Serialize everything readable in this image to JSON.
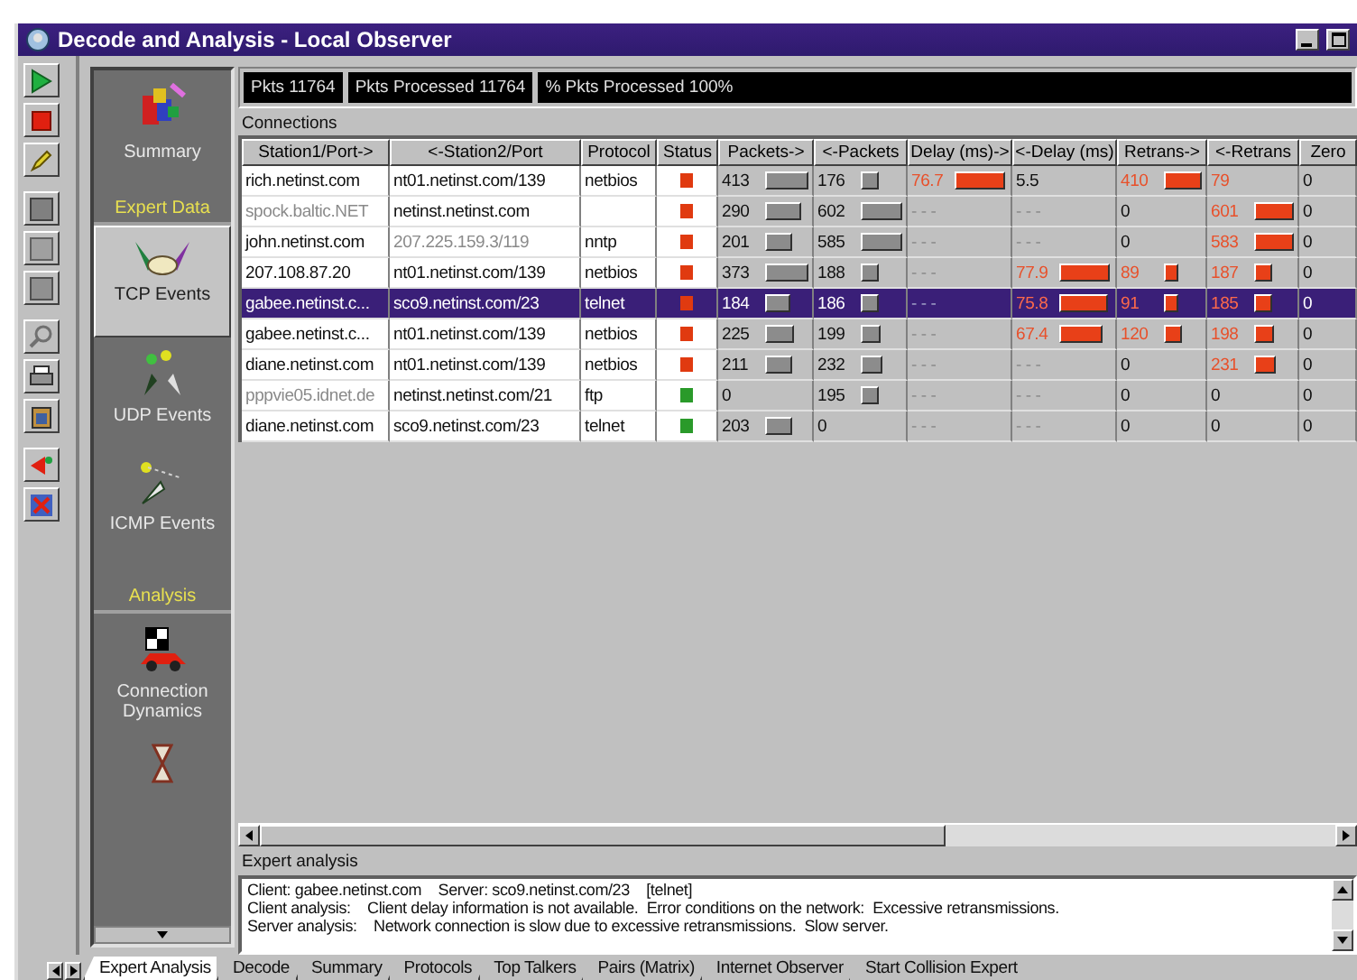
{
  "window": {
    "title": "Decode and Analysis - Local Observer"
  },
  "stats": [
    "Pkts 11764",
    "Pkts Processed 11764",
    "% Pkts Processed 100%"
  ],
  "sidebar": {
    "items": [
      {
        "kind": "item",
        "label": "Summary",
        "selected": false
      },
      {
        "kind": "heading",
        "label": "Expert Data"
      },
      {
        "kind": "item",
        "label": "TCP Events",
        "selected": true
      },
      {
        "kind": "item",
        "label": "UDP Events",
        "selected": false
      },
      {
        "kind": "item",
        "label": "ICMP Events",
        "selected": false
      },
      {
        "kind": "heading",
        "label": "Analysis"
      },
      {
        "kind": "item",
        "label": "Connection Dynamics",
        "selected": false
      },
      {
        "kind": "item",
        "selected": false
      }
    ]
  },
  "connections": {
    "label": "Connections",
    "columns": [
      "Station1/Port->",
      "<-Station2/Port",
      "Protocol",
      "Status",
      "Packets->",
      "<-Packets",
      "Delay (ms)->",
      "<-Delay (ms)",
      "Retrans->",
      "<-Retrans",
      "Zero"
    ],
    "rows": [
      {
        "selected": false,
        "station1": {
          "text": "rich.netinst.com",
          "dim": false
        },
        "station2": {
          "text": "nt01.netinst.com/139",
          "dim": false
        },
        "protocol": "netbios",
        "status": {
          "color": "#e03a10"
        },
        "metrics": [
          {
            "text": "413",
            "bar": true,
            "alert": false
          },
          {
            "text": "176",
            "bar": true,
            "alert": false
          },
          {
            "text": "76.7",
            "bar": true,
            "alert": true
          },
          {
            "text": "5.5",
            "bar": false,
            "alert": false
          },
          {
            "text": "410",
            "bar": true,
            "alert": true
          },
          {
            "text": "79",
            "bar": false,
            "alert": true
          },
          {
            "text": "0",
            "bar": false,
            "alert": false
          }
        ]
      },
      {
        "selected": false,
        "station1": {
          "text": "spock.baltic.NET",
          "dim": true
        },
        "station2": {
          "text": "netinst.netinst.com",
          "dim": false
        },
        "protocol": "",
        "status": {
          "color": "#e03a10"
        },
        "metrics": [
          {
            "text": "290",
            "bar": true,
            "alert": false
          },
          {
            "text": "602",
            "bar": true,
            "alert": false
          },
          {
            "text": "- - -",
            "bar": false,
            "alert": false
          },
          {
            "text": "- - -",
            "bar": false,
            "alert": false
          },
          {
            "text": "0",
            "bar": false,
            "alert": false
          },
          {
            "text": "601",
            "bar": true,
            "alert": true
          },
          {
            "text": "0",
            "bar": false,
            "alert": false
          }
        ]
      },
      {
        "selected": false,
        "station1": {
          "text": "john.netinst.com",
          "dim": false
        },
        "station2": {
          "text": "207.225.159.3/119",
          "dim": true
        },
        "protocol": "nntp",
        "status": {
          "color": "#e03a10"
        },
        "metrics": [
          {
            "text": "201",
            "bar": true,
            "alert": false
          },
          {
            "text": "585",
            "bar": true,
            "alert": false
          },
          {
            "text": "- - -",
            "bar": false,
            "alert": false
          },
          {
            "text": "- - -",
            "bar": false,
            "alert": false
          },
          {
            "text": "0",
            "bar": false,
            "alert": false
          },
          {
            "text": "583",
            "bar": true,
            "alert": true
          },
          {
            "text": "0",
            "bar": false,
            "alert": false
          }
        ]
      },
      {
        "selected": false,
        "station1": {
          "text": "207.108.87.20",
          "dim": false
        },
        "station2": {
          "text": "nt01.netinst.com/139",
          "dim": false
        },
        "protocol": "netbios",
        "status": {
          "color": "#e03a10"
        },
        "metrics": [
          {
            "text": "373",
            "bar": true,
            "alert": false
          },
          {
            "text": "188",
            "bar": true,
            "alert": false
          },
          {
            "text": "- - -",
            "bar": false,
            "alert": false
          },
          {
            "text": "77.9",
            "bar": true,
            "alert": true
          },
          {
            "text": "89",
            "bar": true,
            "alert": true
          },
          {
            "text": "187",
            "bar": true,
            "alert": true
          },
          {
            "text": "0",
            "bar": false,
            "alert": false
          }
        ]
      },
      {
        "selected": true,
        "station1": {
          "text": "gabee.netinst.c...",
          "dim": false
        },
        "station2": {
          "text": "sco9.netinst.com/23",
          "dim": false
        },
        "protocol": "telnet",
        "status": {
          "color": "#e03a10"
        },
        "metrics": [
          {
            "text": "184",
            "bar": true,
            "alert": false
          },
          {
            "text": "186",
            "bar": true,
            "alert": false
          },
          {
            "text": "- - -",
            "bar": false,
            "alert": false
          },
          {
            "text": "75.8",
            "bar": true,
            "alert": true
          },
          {
            "text": "91",
            "bar": true,
            "alert": true
          },
          {
            "text": "185",
            "bar": true,
            "alert": true
          },
          {
            "text": "0",
            "bar": false,
            "alert": false
          }
        ]
      },
      {
        "selected": false,
        "station1": {
          "text": "gabee.netinst.c...",
          "dim": false
        },
        "station2": {
          "text": "nt01.netinst.com/139",
          "dim": false
        },
        "protocol": "netbios",
        "status": {
          "color": "#e03a10"
        },
        "metrics": [
          {
            "text": "225",
            "bar": true,
            "alert": false
          },
          {
            "text": "199",
            "bar": true,
            "alert": false
          },
          {
            "text": "- - -",
            "bar": false,
            "alert": false
          },
          {
            "text": "67.4",
            "bar": true,
            "alert": true
          },
          {
            "text": "120",
            "bar": true,
            "alert": true
          },
          {
            "text": "198",
            "bar": true,
            "alert": true
          },
          {
            "text": "0",
            "bar": false,
            "alert": false
          }
        ]
      },
      {
        "selected": false,
        "station1": {
          "text": "diane.netinst.com",
          "dim": false
        },
        "station2": {
          "text": "nt01.netinst.com/139",
          "dim": false
        },
        "protocol": "netbios",
        "status": {
          "color": "#e03a10"
        },
        "metrics": [
          {
            "text": "211",
            "bar": true,
            "alert": false
          },
          {
            "text": "232",
            "bar": true,
            "alert": false
          },
          {
            "text": "- - -",
            "bar": false,
            "alert": false
          },
          {
            "text": "- - -",
            "bar": false,
            "alert": false
          },
          {
            "text": "0",
            "bar": false,
            "alert": false
          },
          {
            "text": "231",
            "bar": true,
            "alert": true
          },
          {
            "text": "0",
            "bar": false,
            "alert": false
          }
        ]
      },
      {
        "selected": false,
        "station1": {
          "text": "pppvie05.idnet.de",
          "dim": true
        },
        "station2": {
          "text": "netinst.netinst.com/21",
          "dim": false
        },
        "protocol": "ftp",
        "status": {
          "color": "#2a9a2a"
        },
        "metrics": [
          {
            "text": "0",
            "bar": false,
            "alert": false
          },
          {
            "text": "195",
            "bar": true,
            "alert": false
          },
          {
            "text": "- - -",
            "bar": false,
            "alert": false
          },
          {
            "text": "- - -",
            "bar": false,
            "alert": false
          },
          {
            "text": "0",
            "bar": false,
            "alert": false
          },
          {
            "text": "0",
            "bar": false,
            "alert": false
          },
          {
            "text": "0",
            "bar": false,
            "alert": false
          }
        ]
      },
      {
        "selected": false,
        "station1": {
          "text": "diane.netinst.com",
          "dim": false
        },
        "station2": {
          "text": "sco9.netinst.com/23",
          "dim": false
        },
        "protocol": "telnet",
        "status": {
          "color": "#2a9a2a"
        },
        "metrics": [
          {
            "text": "203",
            "bar": true,
            "alert": false
          },
          {
            "text": "0",
            "bar": false,
            "alert": false
          },
          {
            "text": "- - -",
            "bar": false,
            "alert": false
          },
          {
            "text": "- - -",
            "bar": false,
            "alert": false
          },
          {
            "text": "0",
            "bar": false,
            "alert": false
          },
          {
            "text": "0",
            "bar": false,
            "alert": false
          },
          {
            "text": "0",
            "bar": false,
            "alert": false
          }
        ]
      }
    ]
  },
  "expert_analysis": {
    "label": "Expert analysis",
    "lines": [
      "Client: gabee.netinst.com    Server: sco9.netinst.com/23    [telnet]",
      "Client analysis:    Client delay information is not available.  Error conditions on the network:  Excessive retransmissions.",
      "Server analysis:    Network connection is slow due to excessive retransmissions.  Slow server."
    ]
  },
  "tabs": [
    {
      "label": "Expert Analysis",
      "selected": true
    },
    {
      "label": "Decode",
      "selected": false
    },
    {
      "label": "Summary",
      "selected": false
    },
    {
      "label": "Protocols",
      "selected": false
    },
    {
      "label": "Top Talkers",
      "selected": false
    },
    {
      "label": "Pairs (Matrix)",
      "selected": false
    },
    {
      "label": "Internet Observer",
      "selected": false
    },
    {
      "label": "Start Collision Expert",
      "selected": false
    }
  ]
}
